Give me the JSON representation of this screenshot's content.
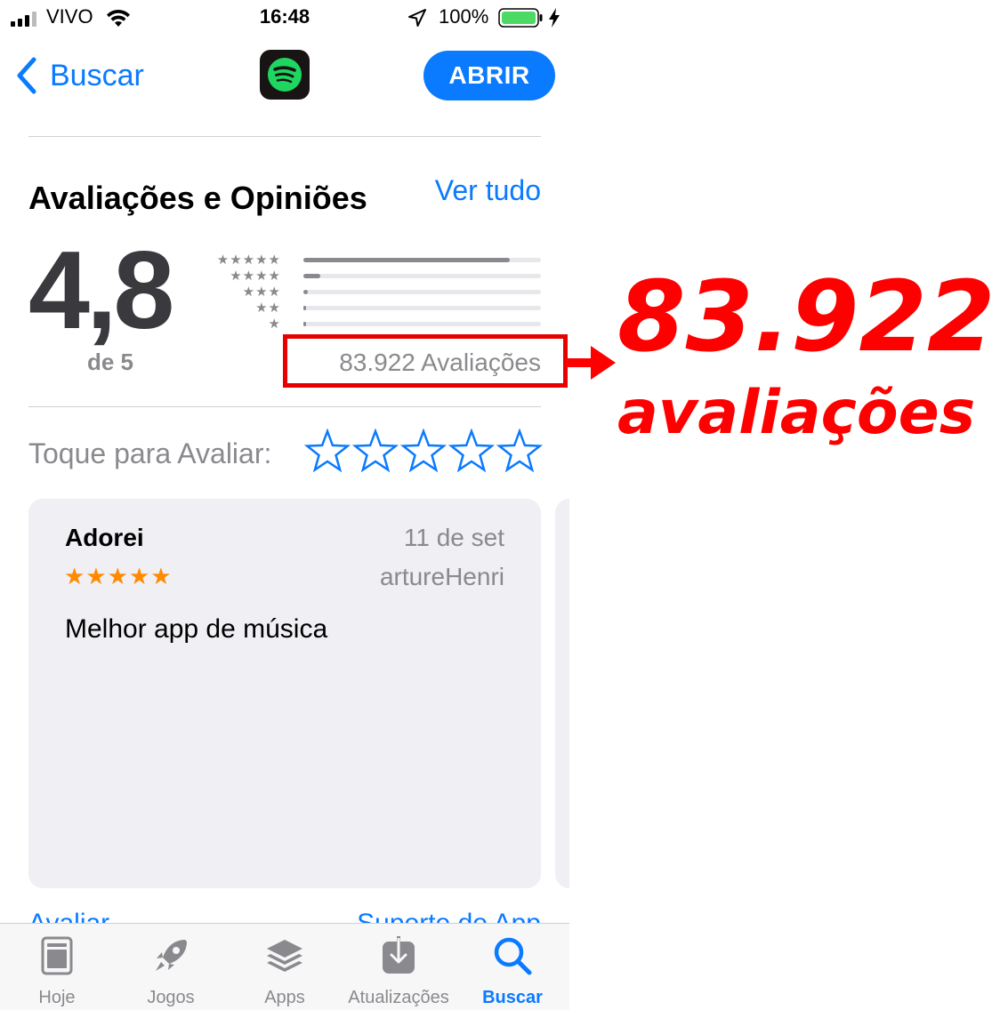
{
  "status_bar": {
    "carrier": "VIVO",
    "time": "16:48",
    "battery": "100%",
    "icons": [
      "signal-icon",
      "wifi-icon",
      "location-icon",
      "battery-icon",
      "charging-bolt-icon"
    ]
  },
  "nav": {
    "back_label": "Buscar",
    "app_icon": "spotify-logo",
    "open_label": "ABRIR"
  },
  "ratings": {
    "section_title": "Avaliações e Opiniões",
    "see_all": "Ver tudo",
    "average": "4,8",
    "out_of": "de 5",
    "histogram": [
      {
        "stars": "★★★★★",
        "fraction": 0.87
      },
      {
        "stars": "★★★★",
        "fraction": 0.07
      },
      {
        "stars": "★★★",
        "fraction": 0.02
      },
      {
        "stars": "★★",
        "fraction": 0.01
      },
      {
        "stars": "★",
        "fraction": 0.01
      }
    ],
    "count": "83.922 Avaliações"
  },
  "tap_to_rate": {
    "label": "Toque para Avaliar:",
    "stars": 5
  },
  "review": {
    "title": "Adorei",
    "date": "11 de set",
    "stars": "★★★★★",
    "author": "artureHenri",
    "body": "Melhor app de música"
  },
  "actions_peek": {
    "left": "Avaliar",
    "right": "Suporte do App"
  },
  "tab_bar": {
    "tabs": [
      {
        "label": "Hoje",
        "icon": "today-icon",
        "active": false
      },
      {
        "label": "Jogos",
        "icon": "rocket-icon",
        "active": false
      },
      {
        "label": "Apps",
        "icon": "layers-icon",
        "active": false
      },
      {
        "label": "Atualizações",
        "icon": "download-icon",
        "active": false
      },
      {
        "label": "Buscar",
        "icon": "search-icon",
        "active": true
      }
    ]
  },
  "annotation": {
    "number": "83.922",
    "word": "avaliações",
    "color": "#ff0000"
  },
  "colors": {
    "accent": "#0a7aff",
    "review_star": "#ff8a00",
    "annotation_red": "#ff0000"
  }
}
